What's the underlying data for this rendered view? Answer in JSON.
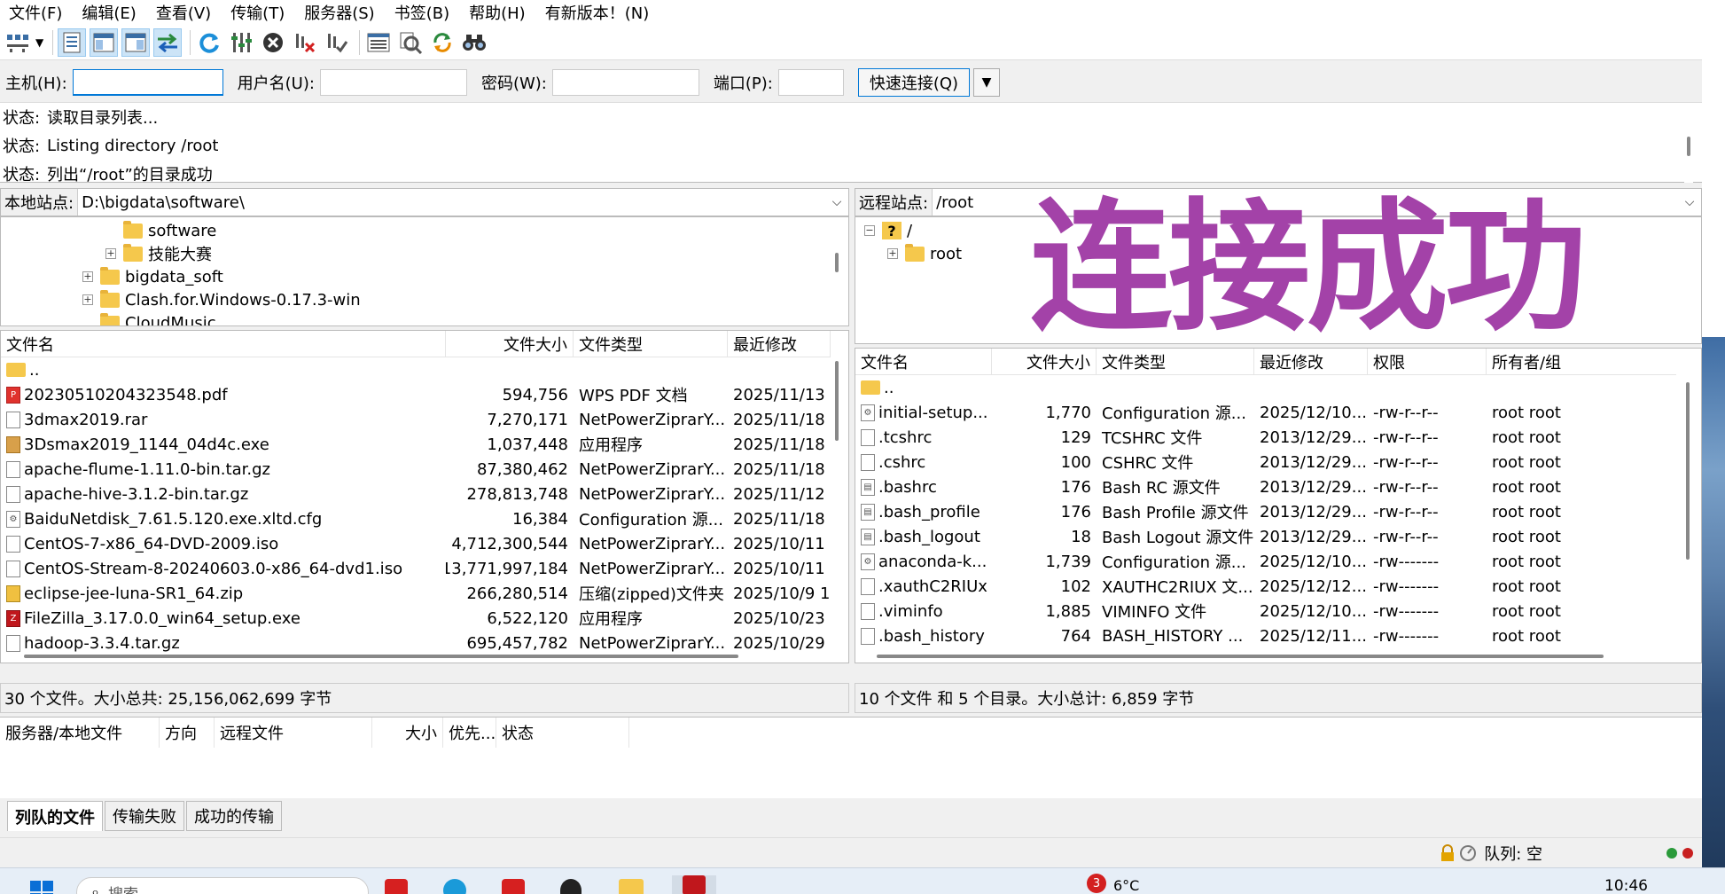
{
  "menu": [
    "文件(F)",
    "编辑(E)",
    "查看(V)",
    "传输(T)",
    "服务器(S)",
    "书签(B)",
    "帮助(H)",
    "有新版本！(N)"
  ],
  "toolbar_icons": [
    "site-manager-icon",
    "dropdown-arrow-icon",
    "message-log-toggle-icon",
    "local-tree-toggle-icon",
    "remote-tree-toggle-icon",
    "transfer-queue-toggle-icon",
    "refresh-icon",
    "filter-process-icon",
    "cancel-icon",
    "disconnect-icon",
    "reconnect-icon",
    "directory-listing-filter-icon",
    "compare-icon",
    "sync-browse-icon",
    "search-binoculars-icon"
  ],
  "quickconnect": {
    "host_label": "主机(H):",
    "host_value": "",
    "user_label": "用户名(U):",
    "user_value": "",
    "pass_label": "密码(W):",
    "pass_value": "",
    "port_label": "端口(P):",
    "port_value": "",
    "button": "快速连接(Q)"
  },
  "log": [
    {
      "status": "状态:",
      "msg": "读取目录列表..."
    },
    {
      "status": "状态:",
      "msg": "Listing directory /root"
    },
    {
      "status": "状态:",
      "msg": "列出“/root”的目录成功"
    }
  ],
  "local": {
    "label": "本地站点:",
    "path": "D:\\bigdata\\software\\",
    "tree": [
      {
        "name": "software",
        "expandable": false
      },
      {
        "name": "技能大赛",
        "expandable": true
      },
      {
        "name": "bigdata_soft",
        "expandable": true
      },
      {
        "name": "Clash.for.Windows-0.17.3-win",
        "expandable": true
      },
      {
        "name": "CloudMusic",
        "expandable": false
      }
    ],
    "columns": [
      "文件名",
      "文件大小",
      "文件类型",
      "最近修改"
    ],
    "files": [
      {
        "name": "..",
        "size": "",
        "type": "",
        "modified": "",
        "icon": "folder"
      },
      {
        "name": "20230510204323548.pdf",
        "size": "594,756",
        "type": "WPS PDF 文档",
        "modified": "2025/11/13",
        "icon": "pdf"
      },
      {
        "name": "3dmax2019.rar",
        "size": "7,270,171",
        "type": "NetPowerZiprarY...",
        "modified": "2025/11/18",
        "icon": "file"
      },
      {
        "name": "3Dsmax2019_1144_04d4c.exe",
        "size": "1,037,448",
        "type": "应用程序",
        "modified": "2025/11/18",
        "icon": "box"
      },
      {
        "name": "apache-flume-1.11.0-bin.tar.gz",
        "size": "87,380,462",
        "type": "NetPowerZiprarY...",
        "modified": "2025/11/18",
        "icon": "file"
      },
      {
        "name": "apache-hive-3.1.2-bin.tar.gz",
        "size": "278,813,748",
        "type": "NetPowerZiprarY...",
        "modified": "2025/11/12",
        "icon": "file"
      },
      {
        "name": "BaiduNetdisk_7.61.5.120.exe.xltd.cfg",
        "size": "16,384",
        "type": "Configuration 源...",
        "modified": "2025/11/18",
        "icon": "cfg"
      },
      {
        "name": "CentOS-7-x86_64-DVD-2009.iso",
        "size": "4,712,300,544",
        "type": "NetPowerZiprarY...",
        "modified": "2025/10/11",
        "icon": "file"
      },
      {
        "name": "CentOS-Stream-8-20240603.0-x86_64-dvd1.iso",
        "size": "13,771,997,184",
        "type": "NetPowerZiprarY...",
        "modified": "2025/10/11",
        "icon": "file"
      },
      {
        "name": "eclipse-jee-luna-SR1_64.zip",
        "size": "266,280,514",
        "type": "压缩(zipped)文件夹",
        "modified": "2025/10/9 1",
        "icon": "zip"
      },
      {
        "name": "FileZilla_3.17.0.0_win64_setup.exe",
        "size": "6,522,120",
        "type": "应用程序",
        "modified": "2025/10/23",
        "icon": "fz"
      },
      {
        "name": "hadoop-3.3.4.tar.gz",
        "size": "695,457,782",
        "type": "NetPowerZiprarY...",
        "modified": "2025/10/29",
        "icon": "file"
      }
    ],
    "status": "30 个文件。大小总共: 25,156,062,699 字节"
  },
  "remote": {
    "label": "远程站点:",
    "path": "/root",
    "tree": [
      {
        "name": "/",
        "expandable": true,
        "icon": "question"
      },
      {
        "name": "root",
        "expandable": true,
        "icon": "folder"
      }
    ],
    "columns": [
      "文件名",
      "文件大小",
      "文件类型",
      "最近修改",
      "权限",
      "所有者/组"
    ],
    "files": [
      {
        "name": "..",
        "size": "",
        "type": "",
        "modified": "",
        "perm": "",
        "owner": "",
        "icon": "folder"
      },
      {
        "name": "initial-setup...",
        "size": "1,770",
        "type": "Configuration 源...",
        "modified": "2025/12/10...",
        "perm": "-rw-r--r--",
        "owner": "root root",
        "icon": "cfg"
      },
      {
        "name": ".tcshrc",
        "size": "129",
        "type": "TCSHRC 文件",
        "modified": "2013/12/29...",
        "perm": "-rw-r--r--",
        "owner": "root root",
        "icon": "file"
      },
      {
        "name": ".cshrc",
        "size": "100",
        "type": "CSHRC 文件",
        "modified": "2013/12/29...",
        "perm": "-rw-r--r--",
        "owner": "root root",
        "icon": "file"
      },
      {
        "name": ".bashrc",
        "size": "176",
        "type": "Bash RC 源文件",
        "modified": "2013/12/29...",
        "perm": "-rw-r--r--",
        "owner": "root root",
        "icon": "src"
      },
      {
        "name": ".bash_profile",
        "size": "176",
        "type": "Bash Profile 源文件",
        "modified": "2013/12/29...",
        "perm": "-rw-r--r--",
        "owner": "root root",
        "icon": "src"
      },
      {
        "name": ".bash_logout",
        "size": "18",
        "type": "Bash Logout 源文件",
        "modified": "2013/12/29...",
        "perm": "-rw-r--r--",
        "owner": "root root",
        "icon": "src"
      },
      {
        "name": "anaconda-k...",
        "size": "1,739",
        "type": "Configuration 源...",
        "modified": "2025/12/10...",
        "perm": "-rw-------",
        "owner": "root root",
        "icon": "cfg"
      },
      {
        "name": ".xauthC2RIUx",
        "size": "102",
        "type": "XAUTHC2RIUX 文...",
        "modified": "2025/12/12...",
        "perm": "-rw-------",
        "owner": "root root",
        "icon": "file"
      },
      {
        "name": ".viminfo",
        "size": "1,885",
        "type": "VIMINFO 文件",
        "modified": "2025/12/10...",
        "perm": "-rw-------",
        "owner": "root root",
        "icon": "file"
      },
      {
        "name": ".bash_history",
        "size": "764",
        "type": "BASH_HISTORY ...",
        "modified": "2025/12/11...",
        "perm": "-rw-------",
        "owner": "root root",
        "icon": "file"
      }
    ],
    "status": "10 个文件 和 5 个目录。大小总计: 6,859 字节"
  },
  "queue": {
    "columns": [
      "服务器/本地文件",
      "方向",
      "远程文件",
      "大小",
      "优先...",
      "状态"
    ],
    "tabs": [
      "列队的文件",
      "传输失败",
      "成功的传输"
    ]
  },
  "bottom": {
    "queue_status": "队列: 空"
  },
  "overlay_text": "连接成功",
  "taskbar": {
    "search": "搜索",
    "badge": "3",
    "weather": "6°C",
    "time": "10:46"
  },
  "colors": {
    "overlay": "#a342a8",
    "accent": "#0078d7"
  }
}
